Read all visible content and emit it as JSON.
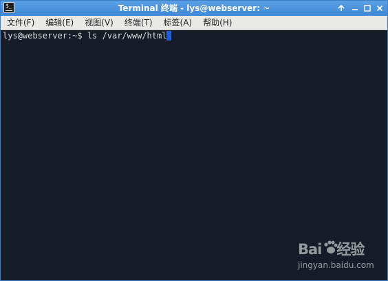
{
  "window": {
    "title": "Terminal 终端 - lys@webserver: ~"
  },
  "menubar": {
    "items": [
      "文件(F)",
      "编辑(E)",
      "视图(V)",
      "终端(T)",
      "标签(A)",
      "帮助(H)"
    ]
  },
  "terminal": {
    "prompt": "lys@webserver:~$ ",
    "command": "ls /var/www/html"
  },
  "watermark": {
    "logo_left": "Bai",
    "logo_right": "经验",
    "url": "jingyan.baidu.com"
  },
  "icons": {
    "app": "terminal-icon",
    "up": "arrow-up-icon",
    "minimize": "minimize-icon",
    "maximize": "maximize-icon",
    "close": "close-icon"
  },
  "colors": {
    "titlebar": "#4a90d9",
    "terminal_bg": "#151b27",
    "cursor": "#1f5ed4"
  }
}
